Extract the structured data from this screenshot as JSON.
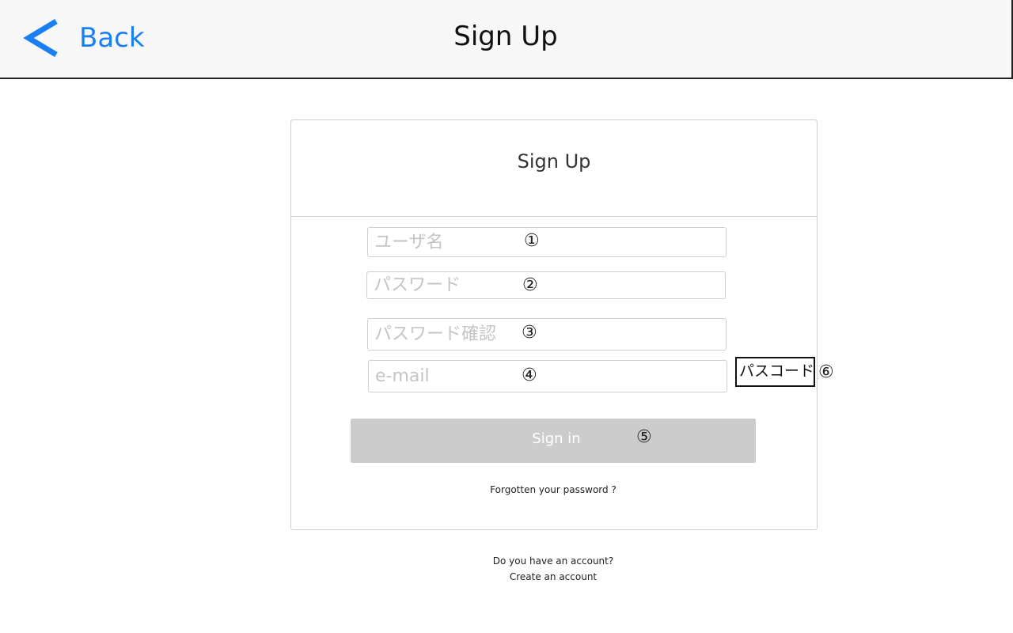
{
  "navbar": {
    "back_label": "Back",
    "back_icon": "chevron-left-icon",
    "title": "Sign Up",
    "accent_color": "#1a7ff2"
  },
  "card": {
    "title": "Sign Up",
    "fields": {
      "username": {
        "placeholder": "ユーザ名",
        "marker": "①"
      },
      "password": {
        "placeholder": "パスワード",
        "marker": "②"
      },
      "password_confirm": {
        "placeholder": "パスワード確認",
        "marker": "③"
      },
      "email": {
        "placeholder": "e-mail",
        "marker": "④"
      }
    },
    "passcode": {
      "label": "パスコード",
      "marker": "⑥"
    },
    "signin": {
      "label": "Sign in",
      "marker": "⑤",
      "bg_color": "#cccccc"
    },
    "forgot_password": "Forgotten your password ?"
  },
  "footer": {
    "question": "Do you have an account?",
    "create_link": "Create an account"
  }
}
